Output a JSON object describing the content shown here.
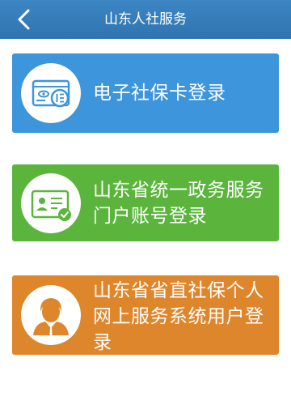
{
  "header": {
    "title": "山东人社服务",
    "back_icon": "chevron-left-icon",
    "background": "#3680bd"
  },
  "login_options": [
    {
      "label": "电子社保卡登录",
      "icon": "social-security-card-icon",
      "color": "#3d95dc"
    },
    {
      "label": "山东省统一政务服务门户账号登录",
      "icon": "id-card-check-icon",
      "color": "#5bb53c"
    },
    {
      "label": "山东省省直社保个人网上服务系统用户登录",
      "icon": "person-avatar-icon",
      "color": "#de862b"
    }
  ]
}
